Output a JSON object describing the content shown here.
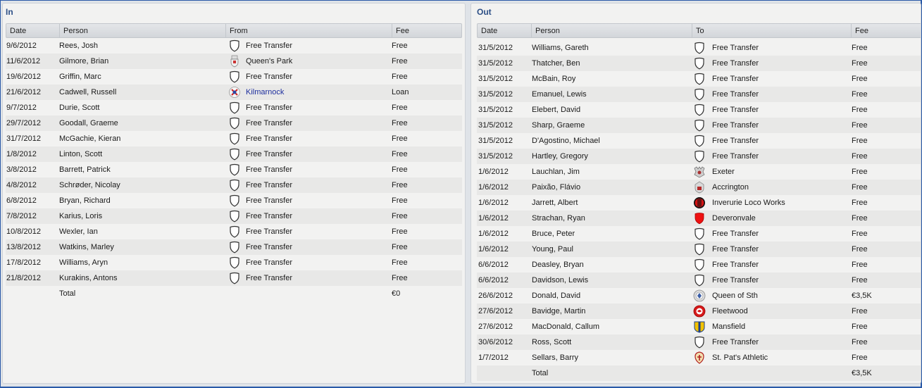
{
  "in": {
    "title": "In",
    "columns": {
      "date": "Date",
      "person": "Person",
      "club": "From",
      "fee": "Fee"
    },
    "rows": [
      {
        "date": "9/6/2012",
        "person": "Rees, Josh",
        "club": "Free Transfer",
        "badge": "shield-icon",
        "fee": "Free"
      },
      {
        "date": "11/6/2012",
        "person": "Gilmore, Brian",
        "club": "Queen's Park",
        "badge": "queens-park-crest-icon",
        "fee": "Free"
      },
      {
        "date": "19/6/2012",
        "person": "Griffin, Marc",
        "club": "Free Transfer",
        "badge": "shield-icon",
        "fee": "Free"
      },
      {
        "date": "21/6/2012",
        "person": "Cadwell, Russell",
        "club": "Kilmarnock",
        "badge": "kilmarnock-crest-icon",
        "fee": "Loan",
        "link": true
      },
      {
        "date": "9/7/2012",
        "person": "Durie, Scott",
        "club": "Free Transfer",
        "badge": "shield-icon",
        "fee": "Free"
      },
      {
        "date": "29/7/2012",
        "person": "Goodall, Graeme",
        "club": "Free Transfer",
        "badge": "shield-icon",
        "fee": "Free"
      },
      {
        "date": "31/7/2012",
        "person": "McGachie, Kieran",
        "club": "Free Transfer",
        "badge": "shield-icon",
        "fee": "Free"
      },
      {
        "date": "1/8/2012",
        "person": "Linton, Scott",
        "club": "Free Transfer",
        "badge": "shield-icon",
        "fee": "Free"
      },
      {
        "date": "3/8/2012",
        "person": "Barrett, Patrick",
        "club": "Free Transfer",
        "badge": "shield-icon",
        "fee": "Free"
      },
      {
        "date": "4/8/2012",
        "person": "Schrøder, Nicolay",
        "club": "Free Transfer",
        "badge": "shield-icon",
        "fee": "Free"
      },
      {
        "date": "6/8/2012",
        "person": "Bryan, Richard",
        "club": "Free Transfer",
        "badge": "shield-icon",
        "fee": "Free"
      },
      {
        "date": "7/8/2012",
        "person": "Karius, Loris",
        "club": "Free Transfer",
        "badge": "shield-icon",
        "fee": "Free"
      },
      {
        "date": "10/8/2012",
        "person": "Wexler, Ian",
        "club": "Free Transfer",
        "badge": "shield-icon",
        "fee": "Free"
      },
      {
        "date": "13/8/2012",
        "person": "Watkins, Marley",
        "club": "Free Transfer",
        "badge": "shield-icon",
        "fee": "Free"
      },
      {
        "date": "17/8/2012",
        "person": "Williams, Aryn",
        "club": "Free Transfer",
        "badge": "shield-icon",
        "fee": "Free"
      },
      {
        "date": "21/8/2012",
        "person": "Kurakins, Antons",
        "club": "Free Transfer",
        "badge": "shield-icon",
        "fee": "Free"
      }
    ],
    "total": {
      "label": "Total",
      "fee": "€0"
    }
  },
  "out": {
    "title": "Out",
    "columns": {
      "date": "Date",
      "person": "Person",
      "club": "To",
      "fee": "Fee"
    },
    "rows": [
      {
        "date": "31/5/2012",
        "person": "Williams, Gareth",
        "club": "Free Transfer",
        "badge": "shield-icon",
        "fee": "Free"
      },
      {
        "date": "31/5/2012",
        "person": "Thatcher, Ben",
        "club": "Free Transfer",
        "badge": "shield-icon",
        "fee": "Free"
      },
      {
        "date": "31/5/2012",
        "person": "McBain, Roy",
        "club": "Free Transfer",
        "badge": "shield-icon",
        "fee": "Free"
      },
      {
        "date": "31/5/2012",
        "person": "Emanuel, Lewis",
        "club": "Free Transfer",
        "badge": "shield-icon",
        "fee": "Free"
      },
      {
        "date": "31/5/2012",
        "person": "Elebert, David",
        "club": "Free Transfer",
        "badge": "shield-icon",
        "fee": "Free"
      },
      {
        "date": "31/5/2012",
        "person": "Sharp, Graeme",
        "club": "Free Transfer",
        "badge": "shield-icon",
        "fee": "Free"
      },
      {
        "date": "31/5/2012",
        "person": "D'Agostino, Michael",
        "club": "Free Transfer",
        "badge": "shield-icon",
        "fee": "Free"
      },
      {
        "date": "31/5/2012",
        "person": "Hartley, Gregory",
        "club": "Free Transfer",
        "badge": "shield-icon",
        "fee": "Free"
      },
      {
        "date": "1/6/2012",
        "person": "Lauchlan, Jim",
        "club": "Exeter",
        "badge": "exeter-crest-icon",
        "fee": "Free"
      },
      {
        "date": "1/6/2012",
        "person": "Paixão, Flávio",
        "club": "Accrington",
        "badge": "accrington-crest-icon",
        "fee": "Free"
      },
      {
        "date": "1/6/2012",
        "person": "Jarrett, Albert",
        "club": "Inverurie Loco Works",
        "badge": "inverurie-crest-icon",
        "fee": "Free"
      },
      {
        "date": "1/6/2012",
        "person": "Strachan, Ryan",
        "club": "Deveronvale",
        "badge": "deveronvale-crest-icon",
        "fee": "Free"
      },
      {
        "date": "1/6/2012",
        "person": "Bruce, Peter",
        "club": "Free Transfer",
        "badge": "shield-icon",
        "fee": "Free"
      },
      {
        "date": "1/6/2012",
        "person": "Young, Paul",
        "club": "Free Transfer",
        "badge": "shield-icon",
        "fee": "Free"
      },
      {
        "date": "6/6/2012",
        "person": "Deasley, Bryan",
        "club": "Free Transfer",
        "badge": "shield-icon",
        "fee": "Free"
      },
      {
        "date": "6/6/2012",
        "person": "Davidson, Lewis",
        "club": "Free Transfer",
        "badge": "shield-icon",
        "fee": "Free"
      },
      {
        "date": "26/6/2012",
        "person": "Donald, David",
        "club": "Queen of Sth",
        "badge": "queen-of-south-crest-icon",
        "fee": "€3,5K"
      },
      {
        "date": "27/6/2012",
        "person": "Bavidge, Martin",
        "club": "Fleetwood",
        "badge": "fleetwood-crest-icon",
        "fee": "Free"
      },
      {
        "date": "27/6/2012",
        "person": "MacDonald, Callum",
        "club": "Mansfield",
        "badge": "mansfield-crest-icon",
        "fee": "Free"
      },
      {
        "date": "30/6/2012",
        "person": "Ross, Scott",
        "club": "Free Transfer",
        "badge": "shield-icon",
        "fee": "Free"
      },
      {
        "date": "1/7/2012",
        "person": "Sellars, Barry",
        "club": "St. Pat's Athletic",
        "badge": "st-pats-crest-icon",
        "fee": "Free"
      }
    ],
    "total": {
      "label": "Total",
      "fee": "€3,5K"
    }
  }
}
